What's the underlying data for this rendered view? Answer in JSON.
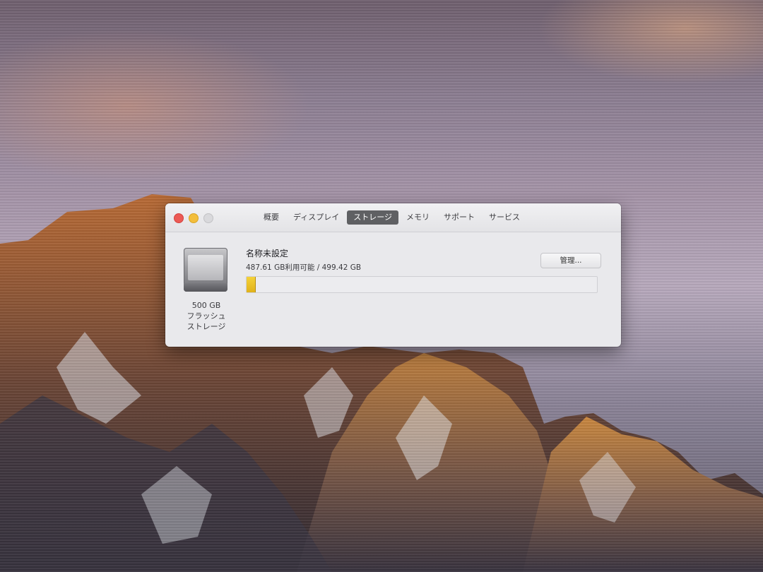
{
  "window": {
    "tabs": [
      {
        "label": "概要",
        "active": false
      },
      {
        "label": "ディスプレイ",
        "active": false
      },
      {
        "label": "ストレージ",
        "active": true
      },
      {
        "label": "メモリ",
        "active": false
      },
      {
        "label": "サポート",
        "active": false
      },
      {
        "label": "サービス",
        "active": false
      }
    ]
  },
  "storage": {
    "drive": {
      "icon": "internal-drive-icon",
      "capacity": "500 GB",
      "type_line1": "フラッシュ",
      "type_line2": "ストレージ"
    },
    "volume_name": "名称未設定",
    "usage_text": "487.61 GB利用可能 / 499.42 GB",
    "used_fraction": 0.024,
    "manage_label": "管理...",
    "colors": {
      "used": "#e8c027",
      "active_tab": "#5f6063"
    }
  }
}
